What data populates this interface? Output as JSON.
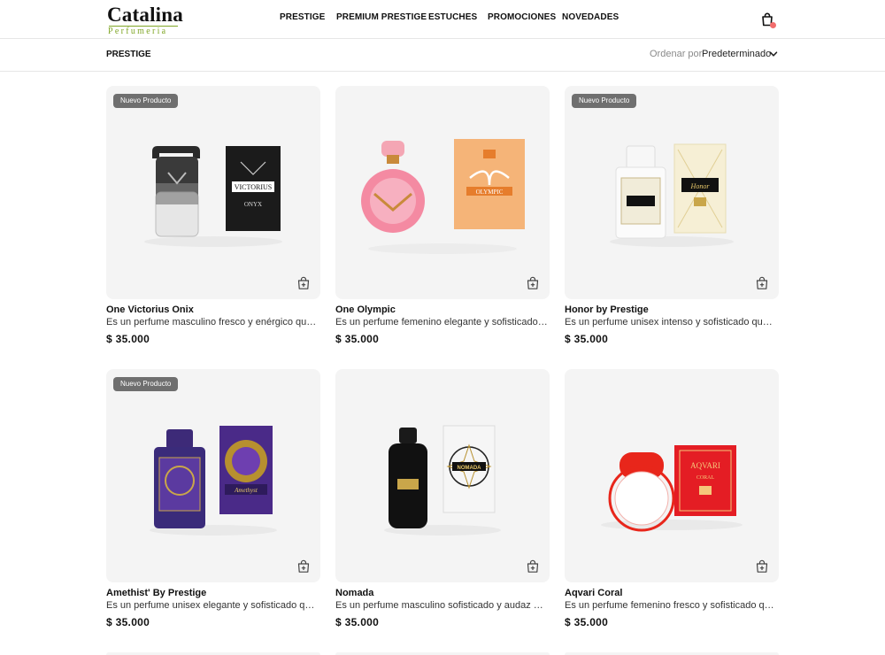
{
  "brand": {
    "name": "Catalina",
    "tagline": "Perfumeria",
    "accent": "#7fa626"
  },
  "nav": {
    "items": [
      {
        "label": "PRESTIGE"
      },
      {
        "label": "PREMIUM PRESTIGE"
      },
      {
        "label": "ESTUCHES"
      },
      {
        "label": "PROMOCIONES"
      },
      {
        "label": "NOVEDADES"
      }
    ],
    "cart_icon": "shopping-bag-icon",
    "cart_dot_color": "#f26d6d"
  },
  "subbar": {
    "breadcrumb": "PRESTIGE",
    "sort_label": "Ordenar por",
    "sort_value": "Predeterminado",
    "sort_icon": "chevron-down-icon"
  },
  "products": [
    {
      "name": "One Victorius Onix",
      "description": "Es un perfume masculino fresco y enérgico que…",
      "price": "$ 35.000",
      "badge": "Nuevo Producto",
      "box_text": "VICTORIUS",
      "box_sub": "ONYX"
    },
    {
      "name": "One Olympic",
      "description": "Es un perfume femenino elegante y sofisticado que…",
      "price": "$ 35.000",
      "badge": "",
      "box_text": "OLYMPIC",
      "box_sub": ""
    },
    {
      "name": "Honor by Prestige",
      "description": "Es un perfume unisex intenso y sofisticado que…",
      "price": "$ 35.000",
      "badge": "Nuevo Producto",
      "box_text": "Honor",
      "box_sub": ""
    },
    {
      "name": "Amethist' By Prestige",
      "description": "Es un perfume unisex elegante y sofisticado que…",
      "price": "$ 35.000",
      "badge": "Nuevo Producto",
      "box_text": "Amethyst",
      "box_sub": ""
    },
    {
      "name": "Nomada",
      "description": "Es un perfume masculino sofisticado y audaz que…",
      "price": "$ 35.000",
      "badge": "",
      "box_text": "NOMADA",
      "box_sub": ""
    },
    {
      "name": "Aqvari Coral",
      "description": "Es un perfume femenino fresco y sofisticado que…",
      "price": "$ 35.000",
      "badge": "",
      "box_text": "AQVARI",
      "box_sub": "CORAL"
    }
  ],
  "add_to_cart_icon": "bag-plus-icon"
}
